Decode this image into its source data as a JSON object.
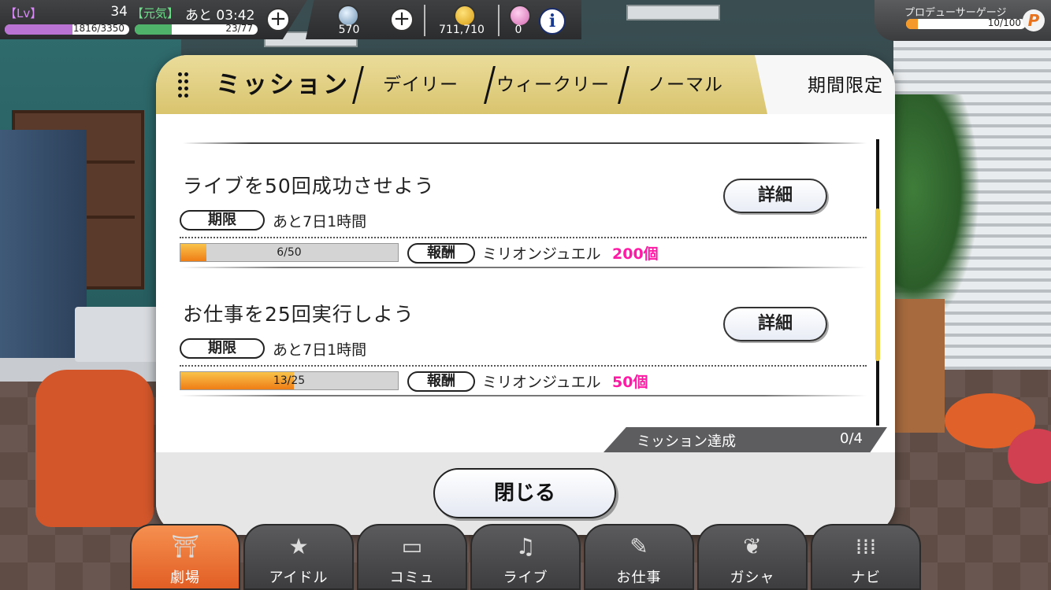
{
  "hud": {
    "level_label": "【Lv】",
    "level": "34",
    "stamina_label": "【元気】",
    "stamina_timer": "あと 03:42",
    "exp_text": "1816/3350",
    "exp_progress": 0.542,
    "stamina_text": "23/77",
    "stamina_progress": 0.299,
    "jewels": "570",
    "coins": "711,710",
    "tickets": "0",
    "producer_gauge_label": "プロデューサーゲージ",
    "producer_gauge_text": "10/100",
    "producer_gauge_progress": 0.1,
    "producer_icon": "P"
  },
  "dialog": {
    "title": "ミッション",
    "tabs": [
      "デイリー",
      "ウィークリー",
      "ノーマル",
      "期間限定"
    ],
    "active_tab": "期間限定",
    "missions": [
      {
        "title": "ライブを50回成功させよう",
        "detail_label": "詳細",
        "deadline_label": "期限",
        "deadline": "あと7日1時間",
        "progress_text": "6/50",
        "progress": 0.12,
        "reward_label": "報酬",
        "reward_item": "ミリオンジュエル",
        "reward_amount": "200個"
      },
      {
        "title": "お仕事を25回実行しよう",
        "detail_label": "詳細",
        "deadline_label": "期限",
        "deadline": "あと7日1時間",
        "progress_text": "13/25",
        "progress": 0.52,
        "reward_label": "報酬",
        "reward_item": "ミリオンジュエル",
        "reward_amount": "50個"
      }
    ],
    "achievement_label": "ミッション達成",
    "achievement_count": "0/4",
    "close_label": "閉じる"
  },
  "nav": [
    {
      "label": "劇場",
      "icon": "theater-icon",
      "active": true
    },
    {
      "label": "アイドル",
      "icon": "idol-icon"
    },
    {
      "label": "コミュ",
      "icon": "commu-icon"
    },
    {
      "label": "ライブ",
      "icon": "music-note-icon"
    },
    {
      "label": "お仕事",
      "icon": "work-icon"
    },
    {
      "label": "ガシャ",
      "icon": "butterfly-icon"
    },
    {
      "label": "ナビ",
      "icon": "grid-dots-icon"
    }
  ],
  "colors": {
    "accent_gold": "#d9c46e",
    "reward_pink": "#ff1aa5",
    "progress_orange": "#ef7d16",
    "nav_active": "#e25e24"
  }
}
